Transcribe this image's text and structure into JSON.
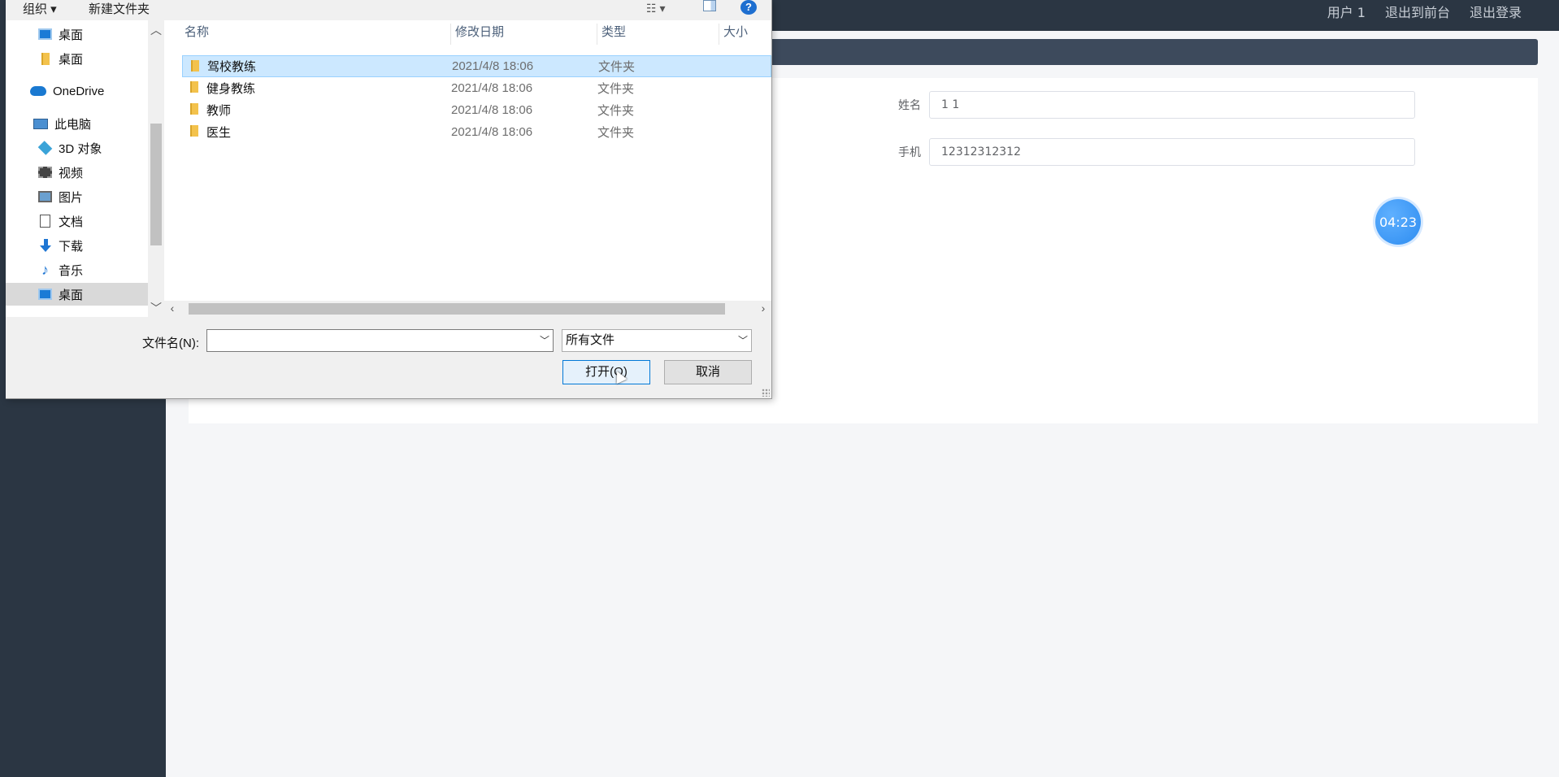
{
  "app": {
    "top_links": [
      "用户 1",
      "退出到前台",
      "退出登录"
    ],
    "form": {
      "name_label": "姓名",
      "name_value": "1 1",
      "phone_label": "手机",
      "phone_value": "12312312312"
    },
    "timer": "04:23"
  },
  "dialog": {
    "toolbar": {
      "organize": "组织 ▾",
      "new_folder": "新建文件夹",
      "view_icon": "view-list-icon",
      "help": "?"
    },
    "nav": [
      {
        "label": "桌面",
        "icon": "desktop-icon"
      },
      {
        "label": "桌面",
        "icon": "folder-icon"
      },
      {
        "label": "OneDrive",
        "icon": "cloud-icon"
      },
      {
        "label": "此电脑",
        "icon": "pc-icon"
      },
      {
        "label": "3D 对象",
        "icon": "3d-objects-icon"
      },
      {
        "label": "视频",
        "icon": "video-icon"
      },
      {
        "label": "图片",
        "icon": "pictures-icon"
      },
      {
        "label": "文档",
        "icon": "documents-icon"
      },
      {
        "label": "下载",
        "icon": "download-icon"
      },
      {
        "label": "音乐",
        "icon": "music-icon"
      },
      {
        "label": "桌面",
        "icon": "desktop-icon"
      }
    ],
    "columns": {
      "name": "名称",
      "date": "修改日期",
      "type": "类型",
      "size": "大小"
    },
    "files": [
      {
        "name": "驾校教练",
        "date": "2021/4/8 18:06",
        "type": "文件夹"
      },
      {
        "name": "健身教练",
        "date": "2021/4/8 18:06",
        "type": "文件夹"
      },
      {
        "name": "教师",
        "date": "2021/4/8 18:06",
        "type": "文件夹"
      },
      {
        "name": "医生",
        "date": "2021/4/8 18:06",
        "type": "文件夹"
      }
    ],
    "filename_label": "文件名(N):",
    "filename_value": "",
    "filter": "所有文件",
    "open_button": "打开(O)",
    "cancel_button": "取消"
  }
}
